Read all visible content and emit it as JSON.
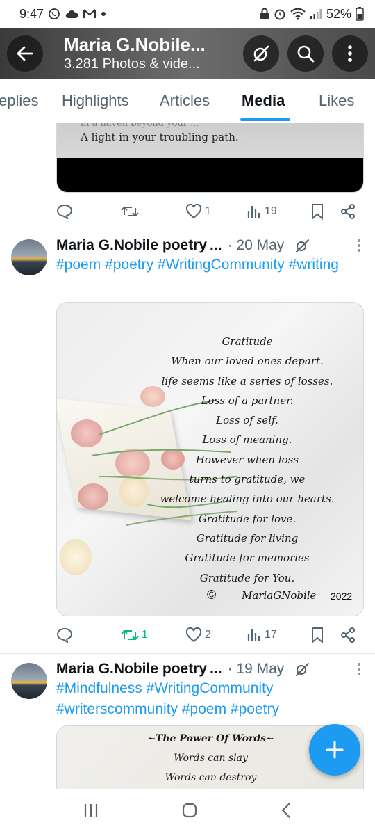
{
  "status": {
    "time": "9:47",
    "battery": "52%"
  },
  "header": {
    "title": "Maria G.Nobile...",
    "subtitle": "3.281 Photos & vide..."
  },
  "tabs": [
    {
      "label": "eplies"
    },
    {
      "label": "Highlights"
    },
    {
      "label": "Articles"
    },
    {
      "label": "Media"
    },
    {
      "label": "Likes"
    }
  ],
  "top_post": {
    "image_text": [
      "in a haven beyond your ...",
      "A light in your troubling path."
    ],
    "actions": {
      "reply": "",
      "retweet": "",
      "like": "1",
      "views": "19"
    }
  },
  "tweets": [
    {
      "name": "Maria G.Nobile poetry",
      "ellipsis": "...",
      "date": "· 20 May",
      "tags": "#poem #poetry #WritingCommunity #writing",
      "poem_title": "Gratitude",
      "poem_lines": [
        "When our loved ones depart.",
        "life seems like a series of losses.",
        "Loss of a partner.",
        "Loss of self.",
        "Loss of meaning.",
        "However when loss",
        "turns to gratitude, we",
        "welcome healing into our hearts.",
        "Gratitude for love.",
        "Gratitude for living",
        "Gratitude for memories",
        "Gratitude for You."
      ],
      "poem_copyright": "©",
      "poem_author": "MariaGNobile",
      "poem_year": "2022",
      "actions": {
        "reply": "",
        "retweet": "1",
        "like": "2",
        "views": "17"
      }
    },
    {
      "name": "Maria G.Nobile poetry",
      "ellipsis": "...",
      "date": "· 19 May",
      "tags": "#Mindfulness #WritingCommunity #writerscommunity #poem #poetry",
      "poem_title": "~The Power Of Words~",
      "poem_lines": [
        "Words can slay",
        "Words can destroy"
      ]
    }
  ],
  "colors": {
    "accent": "#1d9bf0",
    "retweet_active": "#00ba7c",
    "muted": "#536471"
  }
}
